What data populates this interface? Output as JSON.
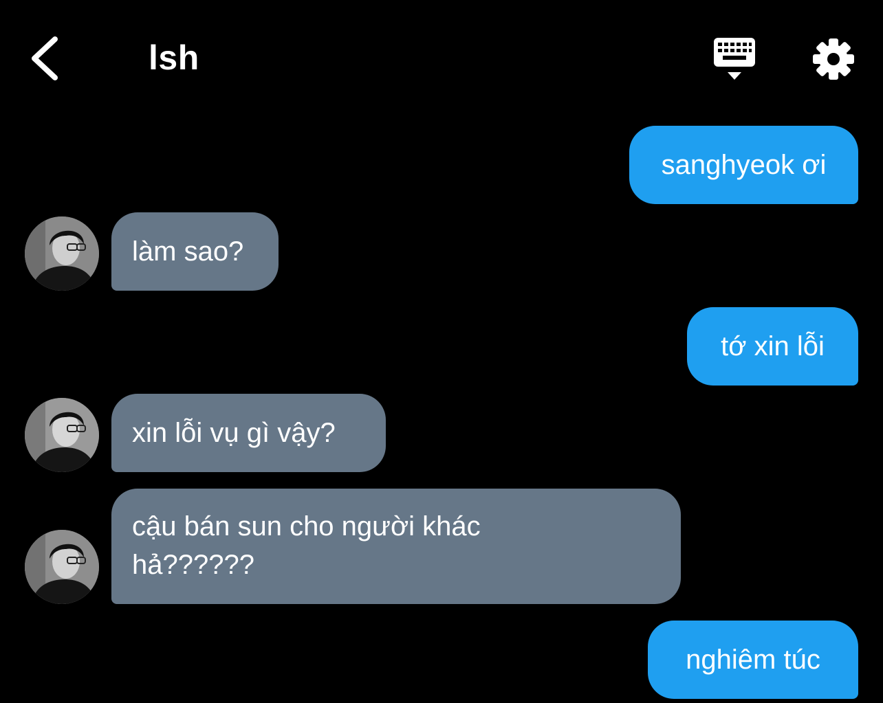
{
  "header": {
    "title": "lsh",
    "back_icon": "chevron-left-icon",
    "keyboard_icon": "keyboard-hide-icon",
    "settings_icon": "gear-icon"
  },
  "colors": {
    "background": "#000000",
    "sent_bubble": "#1f9ff0",
    "received_bubble": "#667788",
    "text": "#ffffff"
  },
  "messages": [
    {
      "from": "me",
      "text": "sanghyeok ơi"
    },
    {
      "from": "lsh",
      "text": "làm sao?"
    },
    {
      "from": "me",
      "text": "tớ xin lỗi"
    },
    {
      "from": "lsh",
      "text": "xin lỗi vụ gì vậy?"
    },
    {
      "from": "lsh",
      "text": "cậu bán sun cho người khác hả??????"
    },
    {
      "from": "me",
      "text": "nghiêm túc"
    }
  ]
}
